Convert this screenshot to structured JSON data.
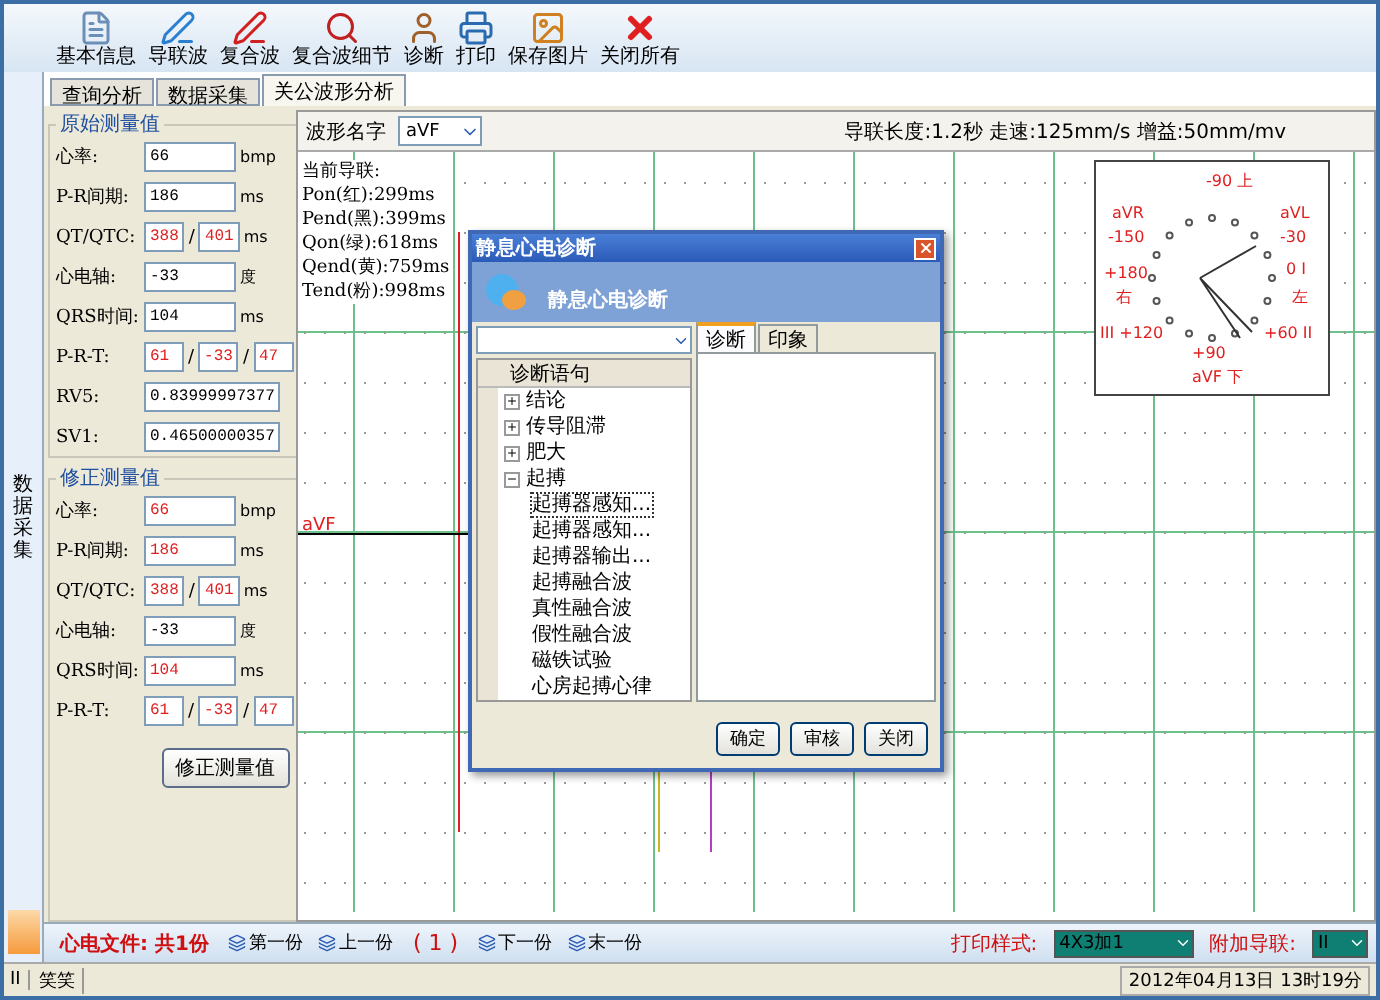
{
  "toolbar": [
    {
      "label": "基本信息",
      "kind": "document"
    },
    {
      "label": "导联波",
      "kind": "pen"
    },
    {
      "label": "复合波",
      "kind": "redpen"
    },
    {
      "label": "复合波细节",
      "kind": "search"
    },
    {
      "label": "诊断",
      "kind": "person"
    },
    {
      "label": "打印",
      "kind": "printer"
    },
    {
      "label": "保存图片",
      "kind": "image"
    },
    {
      "label": "关闭所有",
      "kind": "close"
    }
  ],
  "side_strip": {
    "label": "数据采集"
  },
  "tabs": [
    {
      "label": "查询分析",
      "selected": false
    },
    {
      "label": "数据采集",
      "selected": false
    },
    {
      "label": "关公波形分析",
      "selected": true
    }
  ],
  "original_group": {
    "title": "原始测量值",
    "fields": [
      {
        "label": "心率:",
        "values": [
          {
            "text": "66",
            "alert": false
          }
        ],
        "unit": "bmp"
      },
      {
        "label": "P-R间期:",
        "values": [
          {
            "text": "186",
            "alert": false
          }
        ],
        "unit": "ms"
      },
      {
        "label": "QT/QTC:",
        "separator": "/",
        "values": [
          {
            "text": "388",
            "alert": true
          },
          {
            "text": "401",
            "alert": true
          }
        ],
        "unit": "ms"
      },
      {
        "label": "心电轴:",
        "values": [
          {
            "text": "-33",
            "alert": false
          }
        ],
        "unit": "度"
      },
      {
        "label": "QRS时间:",
        "values": [
          {
            "text": "104",
            "alert": false
          }
        ],
        "unit": "ms"
      },
      {
        "label": "P-R-T:",
        "separator": "/",
        "values": [
          {
            "text": "61",
            "alert": true
          },
          {
            "text": "-33",
            "alert": true
          },
          {
            "text": "47",
            "alert": true
          }
        ]
      },
      {
        "label": "RV5:",
        "values": [
          {
            "text": "0.83999997377",
            "alert": false
          }
        ]
      },
      {
        "label": "SV1:",
        "values": [
          {
            "text": "0.46500000357",
            "alert": false
          }
        ]
      }
    ]
  },
  "corrected_group": {
    "title": "修正测量值",
    "fields": [
      {
        "label": "心率:",
        "values": [
          {
            "text": "66",
            "alert": true
          }
        ],
        "unit": "bmp"
      },
      {
        "label": "P-R间期:",
        "values": [
          {
            "text": "186",
            "alert": true
          }
        ],
        "unit": "ms"
      },
      {
        "label": "QT/QTC:",
        "separator": "/",
        "values": [
          {
            "text": "388",
            "alert": true
          },
          {
            "text": "401",
            "alert": true
          }
        ],
        "unit": "ms"
      },
      {
        "label": "心电轴:",
        "values": [
          {
            "text": "-33",
            "alert": false
          }
        ],
        "unit": "度"
      },
      {
        "label": "QRS时间:",
        "values": [
          {
            "text": "104",
            "alert": true
          }
        ],
        "unit": "ms"
      },
      {
        "label": "P-R-T:",
        "separator": "/",
        "values": [
          {
            "text": "61",
            "alert": true
          },
          {
            "text": "-33",
            "alert": true
          },
          {
            "text": "47",
            "alert": true
          }
        ]
      }
    ],
    "button": "修正测量值"
  },
  "waveform": {
    "label": "波形名字",
    "select": "aVF",
    "info": "导联长度:1.2秒 走速:125mm/s 增益:50mm/mv",
    "trace_label": "aVF"
  },
  "current_lead": [
    "当前导联:",
    "Pon(红):299ms",
    "Pend(黑):399ms",
    "Qon(绿):618ms",
    "Qend(黄):759ms",
    "Tend(粉):998ms"
  ],
  "axis_labels": [
    "-90 上",
    "aVR",
    "aVL",
    "-150",
    "-30",
    "+180",
    "0 I",
    "右",
    "左",
    "III +120",
    "+60 II",
    "+90",
    "aVF 下"
  ],
  "dialog": {
    "title": "静息心电诊断",
    "header": "静息心电诊断",
    "tabs": [
      {
        "label": "诊断",
        "selected": true
      },
      {
        "label": "印象",
        "selected": false
      }
    ],
    "tree_header": "诊断语句",
    "tree": [
      {
        "label": "结论",
        "expanded": false
      },
      {
        "label": "传导阻滞",
        "expanded": false
      },
      {
        "label": "肥大",
        "expanded": false
      },
      {
        "label": "起搏",
        "expanded": true,
        "children": [
          {
            "label": "起搏器感知...",
            "selected": true
          },
          {
            "label": "起搏器感知...",
            "selected": false
          },
          {
            "label": "起搏器输出...",
            "selected": false
          },
          {
            "label": "起搏融合波",
            "selected": false
          },
          {
            "label": "真性融合波",
            "selected": false
          },
          {
            "label": "假性融合波",
            "selected": false
          },
          {
            "label": "磁铁试验",
            "selected": false
          },
          {
            "label": "心房起搏心律",
            "selected": false
          }
        ]
      }
    ],
    "buttons": [
      "确定",
      "审核",
      "关闭"
    ]
  },
  "nav": {
    "file_label": "心电文件: 共1份",
    "first": "第一份",
    "prev": "上一份",
    "page": "( 1 )",
    "next": "下一份",
    "last": "末一份",
    "print_label": "打印样式:",
    "print_value": "4X3加1",
    "lead_label": "附加导联:",
    "lead_value": "II"
  },
  "status": {
    "left": [
      "II",
      "笑笑"
    ],
    "right": "2012年04月13日 13时19分"
  }
}
